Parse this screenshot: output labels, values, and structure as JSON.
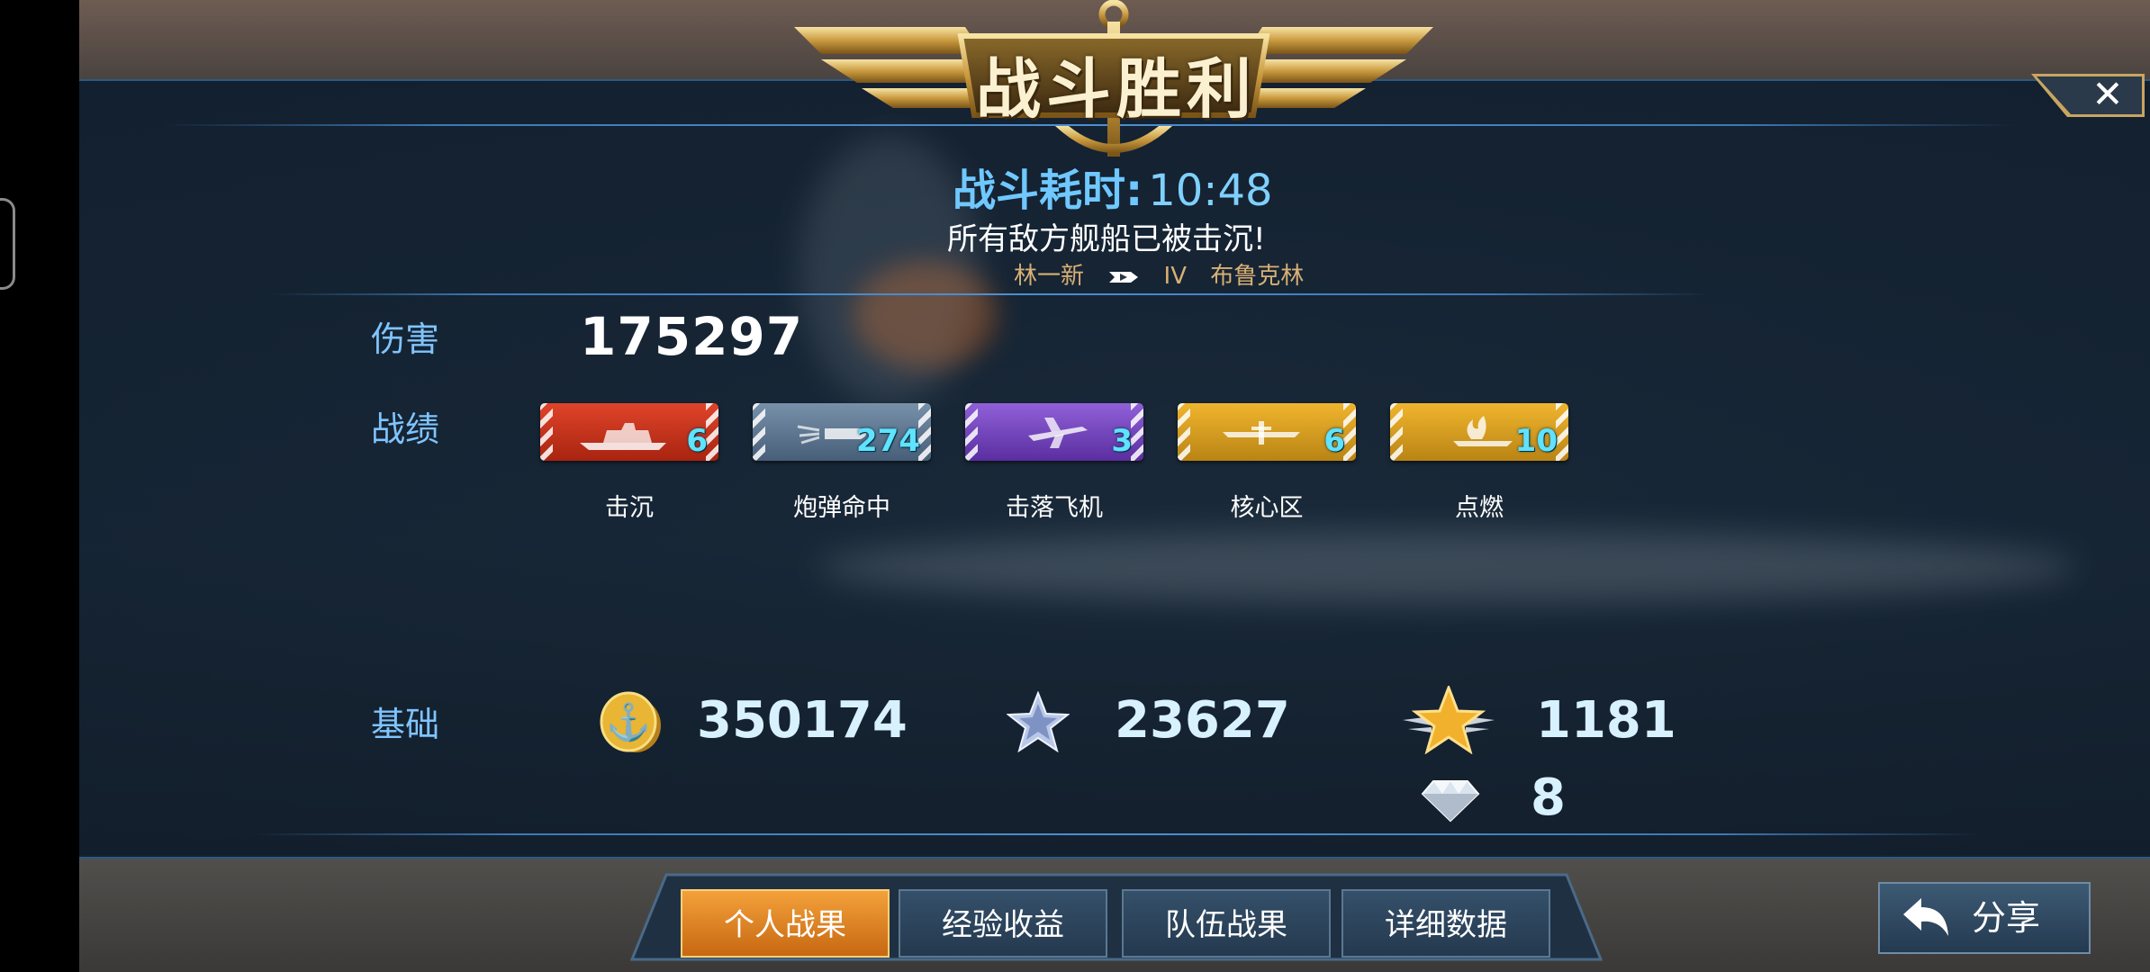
{
  "header": {
    "title": "战斗胜利",
    "close_label": "✕"
  },
  "battle": {
    "time_label": "战斗耗时:",
    "time_value": "10:48",
    "result_text": "所有敌方舰船已被击沉!",
    "player_name": "林一新",
    "ship_tier": "IV",
    "ship_name": "布鲁克林"
  },
  "stats": {
    "damage_label": "伤害",
    "damage_value": "175297",
    "record_label": "战绩",
    "badges": [
      {
        "label": "击沉",
        "count": "6",
        "icon": "warship-icon",
        "color": "#d63a1e"
      },
      {
        "label": "炮弹命中",
        "count": "274",
        "icon": "shell-icon",
        "color": "#5b7896"
      },
      {
        "label": "击落飞机",
        "count": "3",
        "icon": "plane-icon",
        "color": "#7b48c2"
      },
      {
        "label": "核心区",
        "count": "6",
        "icon": "citadel-icon",
        "color": "#dda321"
      },
      {
        "label": "点燃",
        "count": "10",
        "icon": "fire-icon",
        "color": "#dda321"
      }
    ]
  },
  "base": {
    "label": "基础",
    "credits": "350174",
    "credits_icon": "gold-coin-icon",
    "experience": "23627",
    "experience_icon": "silver-star-icon",
    "captain_exp": "1181",
    "captain_exp_icon": "gold-star-wings-icon",
    "diamonds": "8",
    "diamonds_icon": "diamond-icon"
  },
  "tabs": [
    "个人战果",
    "经验收益",
    "队伍战果",
    "详细数据"
  ],
  "share_label": "分享",
  "colors": {
    "accent_blue": "#7fc4ff",
    "gold": "#e8b34a",
    "active_tab": "#f3a13a"
  }
}
